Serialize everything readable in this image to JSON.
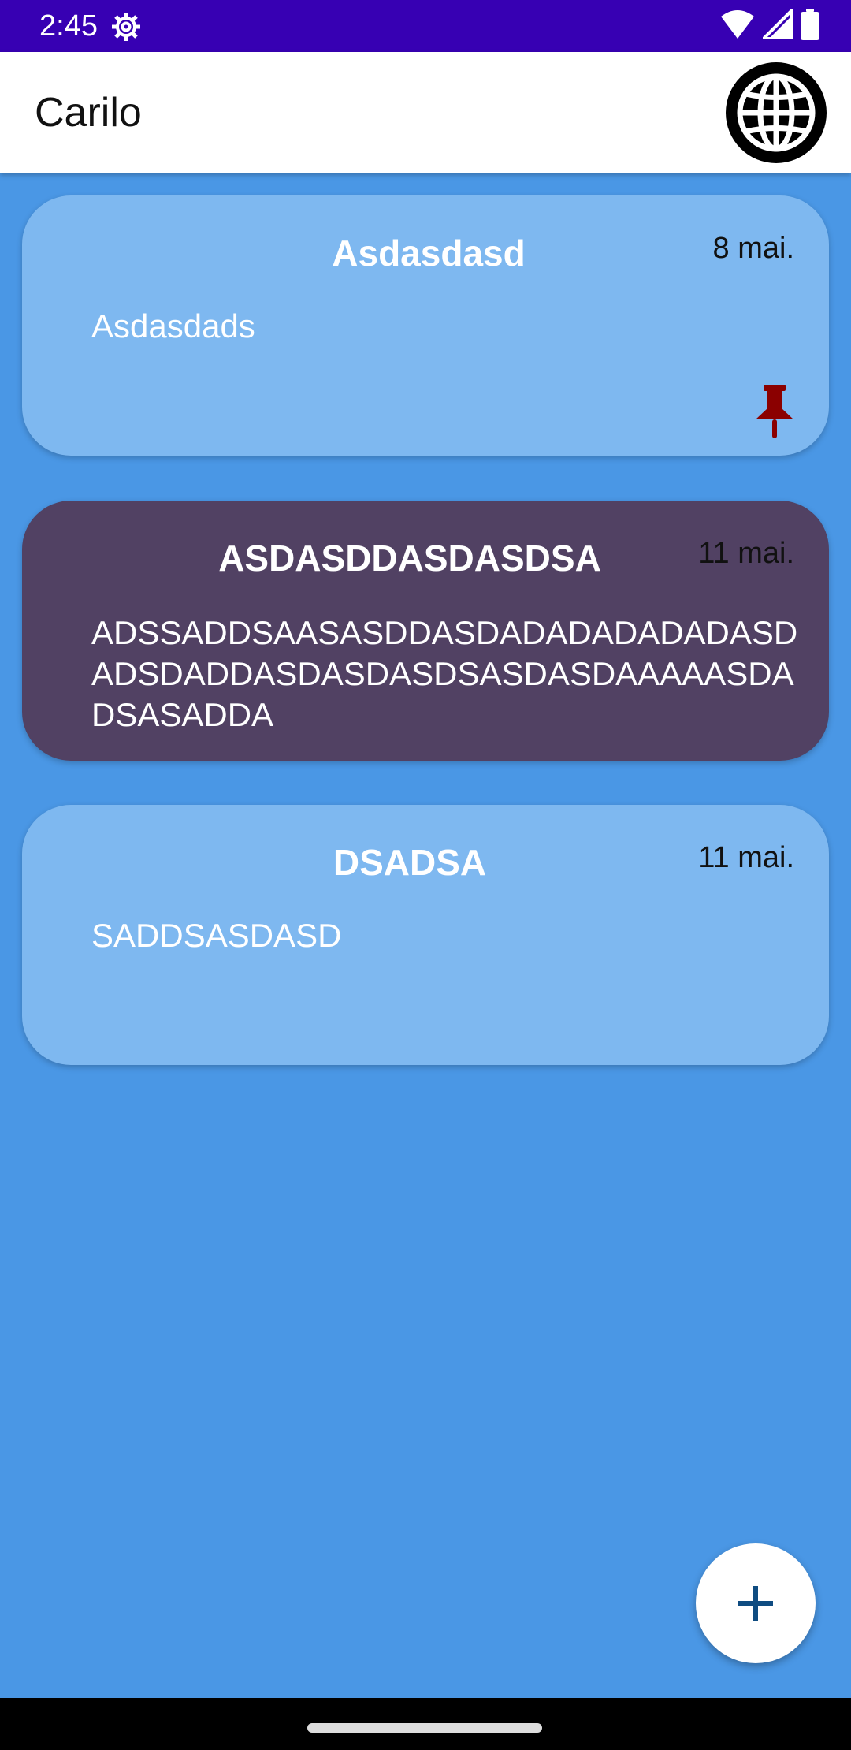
{
  "status_bar": {
    "time": "2:45",
    "icons": [
      "settings-gear-icon",
      "wifi-icon",
      "signal-icon",
      "battery-icon"
    ],
    "background": "#3700b3"
  },
  "app_bar": {
    "title": "Carilo",
    "action_icon": "globe-icon"
  },
  "notes": [
    {
      "title": "Asdasdasd",
      "date": "8 mai.",
      "body": "Asdasdads",
      "pinned": true,
      "color": "#7eb8f0"
    },
    {
      "title": "ASDASDDASDASDSA",
      "date": "11 mai.",
      "body": "ADSSADDSAASASDDASDADADADADADASDADSDADDASDASDASDSASDASDAAAAASDADSASADDA",
      "pinned": false,
      "color": "#514163"
    },
    {
      "title": "DSADSA",
      "date": "11 mai.",
      "body": "SADDSASDASD",
      "pinned": false,
      "color": "#7eb8f0"
    }
  ],
  "fab": {
    "icon": "plus-icon"
  },
  "colors": {
    "background": "#4a97e5",
    "pin": "#8b0000",
    "fab_icon": "#0f4c81"
  }
}
